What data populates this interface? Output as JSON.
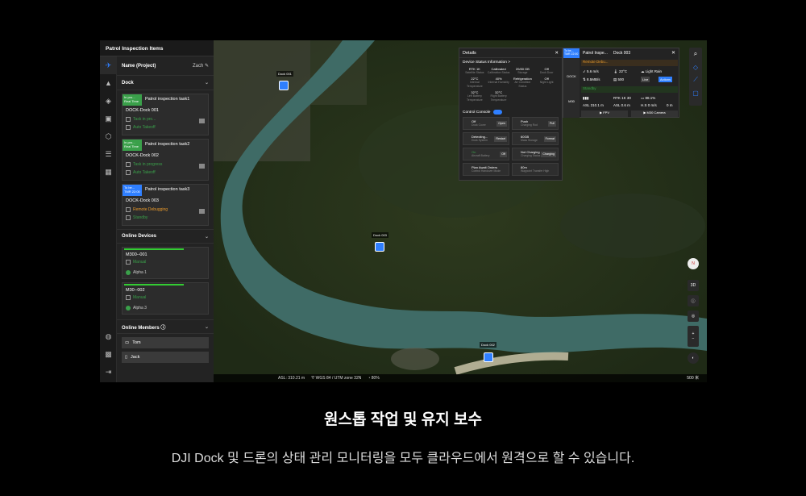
{
  "app": {
    "title": "Patrol Inspection Items"
  },
  "iconbar": [
    "routes-icon",
    "map-icon",
    "layers-icon",
    "media-icon",
    "model-icon",
    "settings-icon",
    "calendar-icon"
  ],
  "project": {
    "label": "Name (Project)",
    "user": "Zach"
  },
  "dock_section": {
    "title": "Dock"
  },
  "tasks": [
    {
      "badge": "In pro... Real Time",
      "badge_color": "#3aa04a",
      "title": "Patrol inspection task1",
      "dock": "DOCK-Dock 001",
      "line1": "Task in pro...",
      "line1_color": "#3aa04a",
      "line2": "Auto Takeoff",
      "line2_color": "#3aa04a"
    },
    {
      "badge": "In pro... Real Time",
      "badge_color": "#3aa04a",
      "title": "Patrol inspection task2",
      "dock": "DOCK-Dock 002",
      "line1": "Task in progress",
      "line1_color": "#3aa04a",
      "line2": "Auto Takeoff",
      "line2_color": "#3aa04a"
    },
    {
      "badge": "To be... TMR 22:00",
      "badge_color": "#2f7fff",
      "title": "Patrol inspection task3",
      "dock": "DOCK-Dock 003",
      "line1": "Remote Debugging",
      "line1_color": "#e89a2c",
      "line2": "Standby",
      "line2_color": "#3aa04a"
    }
  ],
  "online_devices": {
    "title": "Online Devices",
    "items": [
      {
        "name": "M300--001",
        "mode": "Manual",
        "pilot": "Alpha 1"
      },
      {
        "name": "M30--002",
        "mode": "Manual",
        "pilot": "Alpha 3"
      }
    ]
  },
  "online_members": {
    "title": "Online Members",
    "items": [
      "Tom",
      "Jack"
    ]
  },
  "map": {
    "docks": [
      "Dock 001",
      "Dock 003",
      "Dock 002"
    ],
    "status": {
      "asl": "ASL: 310.21 m",
      "crs": "WGS 84 / UTM zone 32N",
      "battery": "80%"
    },
    "scale": "500 米"
  },
  "details": {
    "title": "Details",
    "device_status": "Device Status Information >",
    "stats": [
      {
        "v": "RTK 1K",
        "l": "Satellite Status"
      },
      {
        "v": "Calibrated",
        "l": "Calibration Status"
      },
      {
        "v": "20/80 GB",
        "l": "Storage"
      },
      {
        "v": "Off",
        "l": "Dock Door"
      },
      {
        "v": "22°C",
        "l": "Internal Temperature"
      },
      {
        "v": "40%",
        "l": "Internal Humidity"
      },
      {
        "v": "Refrigeration",
        "l": "Air Condition Status"
      },
      {
        "v": "Off",
        "l": "Night Light"
      },
      {
        "v": "32°C",
        "l": "Left Battery Temperature"
      },
      {
        "v": "32°C",
        "l": "Right Battery Temperature"
      }
    ],
    "control_console": "Control Console",
    "controls": [
      {
        "v": "Off",
        "l": "Dock Cover",
        "b": "Open"
      },
      {
        "v": "Push",
        "l": "Charging Rod",
        "b": "Pull"
      },
      {
        "v": "Detecting...",
        "l": "Dock System",
        "b": "Restart"
      },
      {
        "v": "60GB",
        "l": "Mass Storage",
        "b": "Format"
      },
      {
        "v": "On",
        "l": "Aircraft Battery",
        "b": "Off"
      },
      {
        "v": "Not Charging",
        "l": "Charging Status",
        "b": "Charging"
      },
      {
        "v": "Plan  Await Orders",
        "l": "Control Handover Mode",
        "b": ""
      },
      {
        "v": "80m",
        "l": "Waypoint Transfer High",
        "b": ""
      }
    ]
  },
  "dockpanel": {
    "badge": "To be... TMR 22:00",
    "title": "Patrol Inspe...",
    "dock": "Dock 003",
    "status": "Remote Debu...",
    "wind": "5.6 m/s",
    "temp": "22°C",
    "weather": "Light Rain",
    "net": "8.5MB/s",
    "storage": "500",
    "live": "Live",
    "actions": "Actions",
    "drone": "M30",
    "drone_status": "Standby",
    "rtk": "RTK 1K 30",
    "battery": "88.1%",
    "asl": "ASL 310.1 m",
    "agl": "ASL 0.6 m",
    "hs": "H.S 0 m/s",
    "dist": "0 m",
    "fpv": "FPV",
    "camera": "M30 Camera",
    "dock_lbl": "DOCK"
  },
  "caption": "원스톱 작업 및 유지 보수",
  "subcaption": "DJI Dock 및 드론의 상태 관리 모니터링을 모두 클라우드에서 원격으로 할 수 있습니다."
}
